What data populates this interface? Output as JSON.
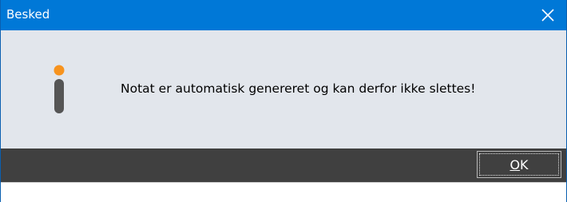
{
  "window": {
    "title": "Besked"
  },
  "dialog": {
    "message": "Notat er automatisk genereret og kan derfor ikke slettes!",
    "icon": "info-icon"
  },
  "buttons": {
    "ok_mnemonic": "O",
    "ok_rest": "K"
  },
  "colors": {
    "titlebar": "#0078d7",
    "content_bg": "#e2e6ec",
    "footer_bg": "#404040",
    "icon_dot": "#f7931e",
    "icon_bar": "#555555"
  }
}
